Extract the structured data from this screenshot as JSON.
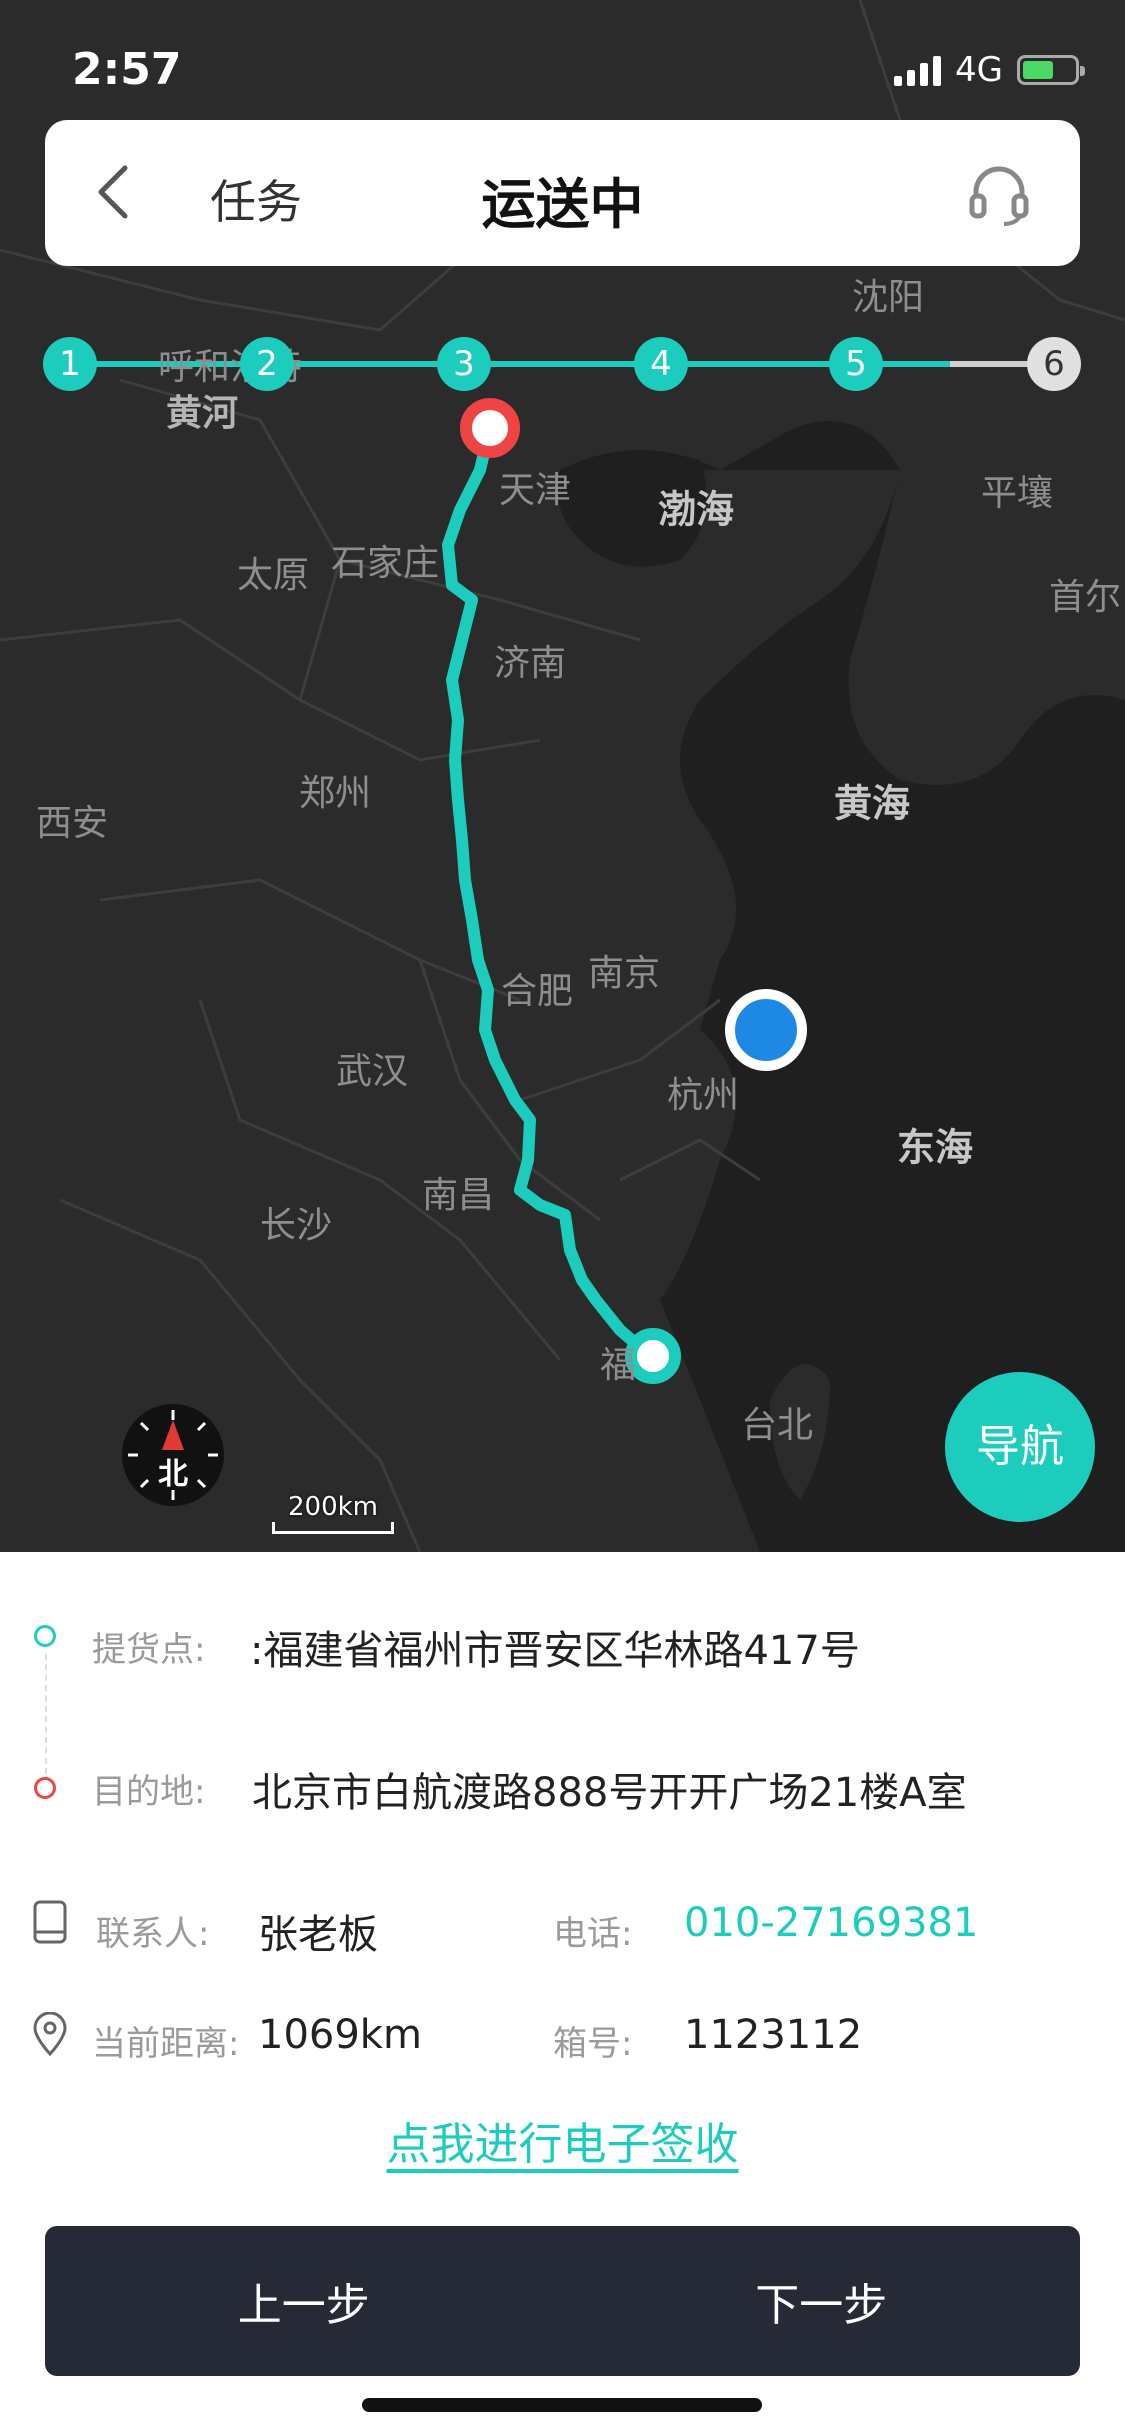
{
  "status": {
    "time": "2:57",
    "network": "4G"
  },
  "header": {
    "back_label": "任务",
    "title": "运送中"
  },
  "stepper": {
    "steps": [
      "1",
      "2",
      "3",
      "4",
      "5",
      "6"
    ],
    "completed": 5
  },
  "map": {
    "cities": [
      "呼和浩特",
      "黄河",
      "沈阳",
      "天津",
      "平壤",
      "太原",
      "石家庄",
      "首尔",
      "济南",
      "郑州",
      "西安",
      "南京",
      "合肥",
      "武汉",
      "杭州",
      "南昌",
      "长沙",
      "福",
      "台北"
    ],
    "seas": [
      "渤海",
      "黄海",
      "东海"
    ],
    "compass_label": "北",
    "scale_label": "200km",
    "nav_label": "导航"
  },
  "info": {
    "pickup_label": "提货点:",
    "pickup_value": ":福建省福州市晋安区华林路417号",
    "dest_label": "目的地:",
    "dest_value": "北京市白航渡路888号开开广场21楼A室",
    "contact_label": "联系人:",
    "contact_value": "张老板",
    "phone_label": "电话:",
    "phone_value": "010-27169381",
    "distance_label": "当前距离:",
    "distance_value": "1069km",
    "box_label": "箱号:",
    "box_value": "1123112",
    "sign_link": "点我进行电子签收"
  },
  "actions": {
    "prev": "上一步",
    "next": "下一步"
  },
  "colors": {
    "accent": "#1ccdbd",
    "destination": "#ef4444",
    "current_location": "#1e88e5",
    "map_bg": "#2b2b2b",
    "bottom_bar": "#252a36"
  }
}
